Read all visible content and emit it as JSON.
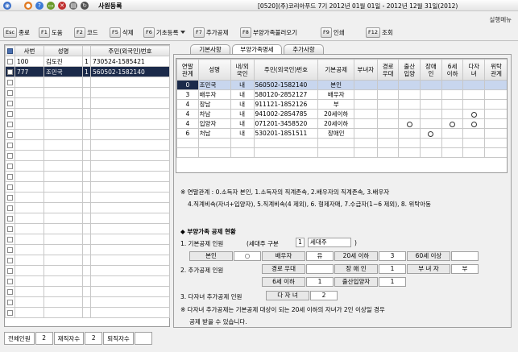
{
  "titlebar": {
    "title": "사원등록",
    "company_info": "[0520](주)코리아푸드 7기 2012년 01월 01일 - 2012년 12월 31일(2012)",
    "help_link": "실행메뉴"
  },
  "toolbar": [
    {
      "key": "Esc",
      "label": "종료"
    },
    {
      "key": "F1",
      "label": "도움"
    },
    {
      "key": "F2",
      "label": "코드"
    },
    {
      "key": "F5",
      "label": "삭제"
    },
    {
      "key": "F6",
      "label": "기초등록"
    },
    {
      "key": "F7",
      "label": "추가공제"
    },
    {
      "key": "F8",
      "label": "부양가족불러오기"
    },
    {
      "key": "F9",
      "label": "인쇄"
    },
    {
      "key": "F12",
      "label": "조회"
    }
  ],
  "employees": {
    "headers": [
      "사번",
      "성명",
      "",
      "주민(외국인)번호"
    ],
    "rows": [
      {
        "id": "100",
        "name": "김도진",
        "type": "1",
        "rrn": "730524-1585421"
      },
      {
        "id": "777",
        "name": "조민국",
        "type": "1",
        "rrn": "560502-1582140"
      }
    ]
  },
  "summary": {
    "total_label": "전체인원",
    "total": "2",
    "active_label": "재직자수",
    "active": "2",
    "retired_label": "퇴직자수",
    "retired": ""
  },
  "tabs": [
    "기본사항",
    "부양가족명세",
    "추가사항"
  ],
  "dependents": {
    "headers": [
      "연말\n관계",
      "성명",
      "내/외\n국인",
      "주민(외국인)번호",
      "기본공제",
      "부녀자",
      "경로\n우대",
      "출산\n입양",
      "장애\n인",
      "6세\n이하",
      "다자\n녀",
      "위탁\n관계"
    ],
    "rows": [
      {
        "rel": "0",
        "name": "조민국",
        "nat": "내",
        "rrn": "560502-1582140",
        "basic": "본인",
        "marks": []
      },
      {
        "rel": "3",
        "name": "배우자",
        "nat": "내",
        "rrn": "580120-2852127",
        "basic": "배우자",
        "marks": []
      },
      {
        "rel": "4",
        "name": "장남",
        "nat": "내",
        "rrn": "911121-1852126",
        "basic": "부",
        "marks": []
      },
      {
        "rel": "4",
        "name": "차남",
        "nat": "내",
        "rrn": "941002-2854785",
        "basic": "20세이하",
        "marks": [
          "다자녀"
        ]
      },
      {
        "rel": "4",
        "name": "입양자",
        "nat": "내",
        "rrn": "071201-3458520",
        "basic": "20세이하",
        "marks": [
          "출산입양",
          "6세이하",
          "다자녀"
        ]
      },
      {
        "rel": "6",
        "name": "처남",
        "nat": "내",
        "rrn": "530201-1851511",
        "basic": "장애인",
        "marks": [
          "장애인"
        ]
      }
    ]
  },
  "relation_note": {
    "line1": "※ 연말관계 : 0.소득자 본인, 1.소득자의 직계존속, 2.배우자의 직계존속, 3.배우자",
    "line2": "4.직계비속(자녀+입양자), 5.직계비속(4 제외), 6. 형제자매, 7.수급자(1~6 제외), 8. 위탁아동"
  },
  "status": {
    "heading": "◆ 부양가족 공제 현황",
    "basic_label": "1. 기본공제 인원",
    "household_label": "(세대주 구분",
    "household_value": "1",
    "household_type": "세대주",
    "household_close": ")",
    "basic_items": [
      {
        "label": "본인",
        "value": "○"
      },
      {
        "label": "배우자",
        "value": "유"
      },
      {
        "label": "20세 이하",
        "value": "3"
      },
      {
        "label": "60세 이상",
        "value": ""
      }
    ],
    "extra_label": "2. 추가공제 인원",
    "extra_items": [
      {
        "label": "경로 우대",
        "value": ""
      },
      {
        "label": "장 애 인",
        "value": "1"
      },
      {
        "label": "부 녀 자",
        "value": "부"
      },
      {
        "label": "6세 이하",
        "value": "1"
      },
      {
        "label": "출산입양자",
        "value": "1"
      }
    ],
    "multi_label": "3. 다자녀 추가공제 인원",
    "multi_box_label": "다 자 녀",
    "multi_value": "2",
    "note1": "※ 다자녀 추가공제는 기본공제 대상이 되는 20세 이하의 자녀가 2인 이상일 경우",
    "note2": "공제 받을 수 있습니다."
  }
}
